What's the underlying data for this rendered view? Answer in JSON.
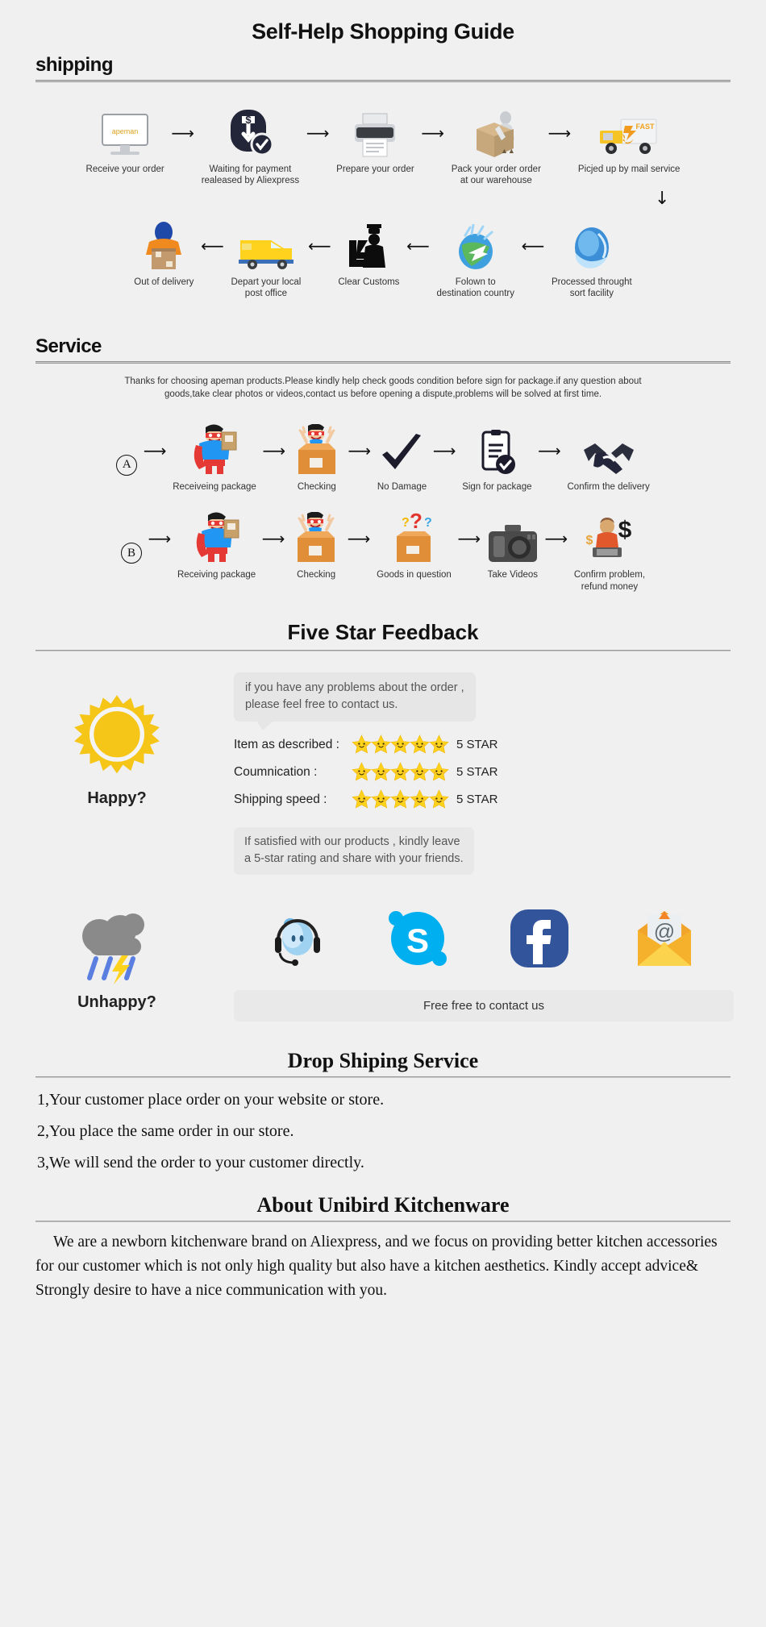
{
  "title": "Self-Help Shopping Guide",
  "shipping": {
    "heading": "shipping",
    "row1": [
      {
        "icon": "monitor-apeman-icon",
        "label": "Receive your order"
      },
      {
        "icon": "payment-shield-dollar-icon",
        "label": "Waiting for payment\nrealeased by Aliexpress"
      },
      {
        "icon": "printer-icon",
        "label": "Prepare your order"
      },
      {
        "icon": "packing-worker-box-icon",
        "label": "Pack your order order\nat our warehouse"
      },
      {
        "icon": "delivery-truck-fast-icon",
        "label": "Picjed up by mail service"
      }
    ],
    "row2": [
      {
        "icon": "courier-delivery-person-icon",
        "label": "Out of delivery"
      },
      {
        "icon": "yellow-postal-van-icon",
        "label": "Depart your local\npost office"
      },
      {
        "icon": "customs-officer-icon",
        "label": "Clear Customs"
      },
      {
        "icon": "globe-airplane-icon",
        "label": "Folown to\ndestination country"
      },
      {
        "icon": "blue-globe-sort-icon",
        "label": "Processed throught\nsort facility"
      }
    ]
  },
  "service": {
    "heading": "Service",
    "note": "Thanks for choosing apeman products.Please kindly help check goods condition before sign for package.if any question about goods,take clear photos or videos,contact us before opening a dispute,problems will be solved at first time.",
    "rowA": {
      "marker": "A",
      "steps": [
        {
          "icon": "superhero-package-icon",
          "label": "Receiveing package"
        },
        {
          "icon": "happy-unboxing-icon",
          "label": "Checking"
        },
        {
          "icon": "checkmark-icon",
          "label": "No Damage"
        },
        {
          "icon": "signed-document-check-icon",
          "label": "Sign for package"
        },
        {
          "icon": "handshake-icon",
          "label": "Confirm the delivery"
        }
      ]
    },
    "rowB": {
      "marker": "B",
      "steps": [
        {
          "icon": "superhero-package-icon",
          "label": "Receiving package"
        },
        {
          "icon": "happy-unboxing-icon",
          "label": "Checking"
        },
        {
          "icon": "question-box-icon",
          "label": "Goods in question"
        },
        {
          "icon": "camera-icon",
          "label": "Take Videos"
        },
        {
          "icon": "refund-agent-dollar-icon",
          "label": "Confirm problem,\nrefund money"
        }
      ]
    }
  },
  "feedback": {
    "heading": "Five Star Feedback",
    "bubble": "if you have any problems about the order ,\nplease feel free to contact us.",
    "happy_label": "Happy?",
    "happy_icon": "sun-icon",
    "ratings": [
      {
        "label": "Item as described :",
        "stars": 5,
        "value": "5 STAR"
      },
      {
        "label": "Coumnication :",
        "stars": 5,
        "value": "5 STAR"
      },
      {
        "label": "Shipping speed :",
        "stars": 5,
        "value": "5 STAR"
      }
    ],
    "satisfied_note": "If satisfied with our products ,  kindly leave\na 5-star rating and share with your friends.",
    "unhappy_label": "Unhappy?",
    "unhappy_icon": "rain-cloud-lightning-icon",
    "channels": [
      {
        "icon": "headset-support-icon",
        "name": "support"
      },
      {
        "icon": "skype-icon",
        "name": "Skype"
      },
      {
        "icon": "facebook-icon",
        "name": "Facebook"
      },
      {
        "icon": "email-envelope-icon",
        "name": "Email"
      }
    ],
    "contact_cta": "Free free to contact us"
  },
  "dropship": {
    "heading": "Drop Shiping Service",
    "items": [
      "1,Your customer place order on your website or store.",
      "2,You place the same order in our store.",
      "3,We will send the order to your customer directly."
    ]
  },
  "about": {
    "heading": "About Unibird Kitchenware",
    "body": "We are a newborn kitchenware brand on Aliexpress, and we focus on providing better kitchen accessories for our customer which is not only high quality but also have a kitchen aesthetics. Kindly accept advice& Strongly desire to have a nice communication with you."
  },
  "colors": {
    "bg": "#f0f0f0",
    "accent_yellow": "#f5c518",
    "skype_blue": "#00aff0",
    "facebook_blue": "#32549a",
    "star_yellow": "#ffd21e"
  }
}
